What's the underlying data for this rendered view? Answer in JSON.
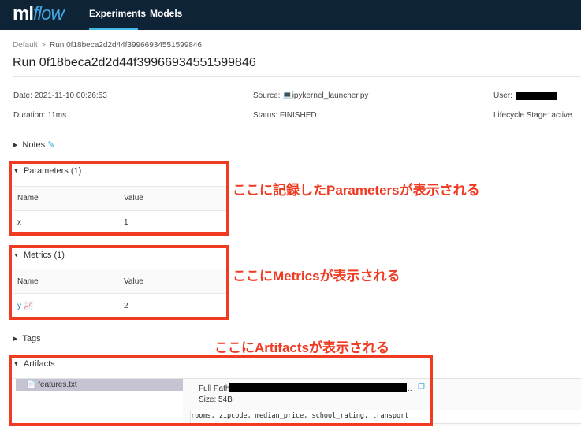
{
  "header": {
    "logo_main": "ml",
    "logo_accent": "flow",
    "nav": [
      "Experiments",
      "Models"
    ]
  },
  "breadcrumb": {
    "parent": "Default",
    "sep": ">",
    "current": "Run 0f18beca2d2d44f39966934551599846"
  },
  "title": "Run 0f18beca2d2d44f39966934551599846",
  "meta": {
    "date_label": "Date:",
    "date": "2021-11-10 00:26:53",
    "source_label": "Source:",
    "source": "ipykernel_launcher.py",
    "user_label": "User:",
    "duration_label": "Duration:",
    "duration": "11ms",
    "status_label": "Status:",
    "status": "FINISHED",
    "lifecycle_label": "Lifecycle Stage:",
    "lifecycle": "active"
  },
  "sections": {
    "notes": "Notes",
    "parameters": "Parameters (1)",
    "metrics": "Metrics (1)",
    "tags": "Tags",
    "artifacts": "Artifacts"
  },
  "table": {
    "name_header": "Name",
    "value_header": "Value"
  },
  "parameters": [
    {
      "name": "x",
      "value": "1"
    }
  ],
  "metrics": [
    {
      "name": "y",
      "value": "2"
    }
  ],
  "artifacts": {
    "file": "features.txt",
    "full_path_label": "Full Path:",
    "ellipsis": "..",
    "size": "Size: 54B",
    "content": "rooms, zipcode, median_price, school_rating, transport"
  },
  "annotations": {
    "params": "ここに記録したParametersが表示される",
    "metrics": "ここにMetricsが表示される",
    "artifacts": "ここにArtifactsが表示される"
  }
}
